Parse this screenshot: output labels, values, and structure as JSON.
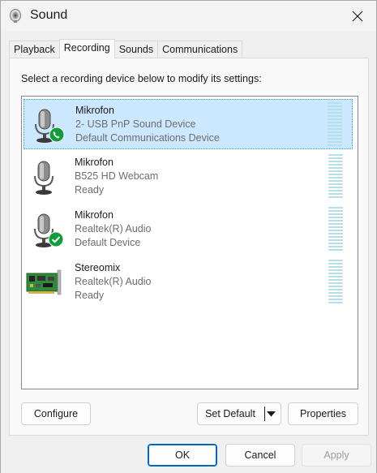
{
  "window": {
    "title": "Sound"
  },
  "tabs": [
    {
      "label": "Playback"
    },
    {
      "label": "Recording"
    },
    {
      "label": "Sounds"
    },
    {
      "label": "Communications"
    }
  ],
  "active_tab": "Recording",
  "instruction": "Select a recording device below to modify its settings:",
  "devices": [
    {
      "name": "Mikrofon",
      "detail": "2- USB PnP Sound Device",
      "status": "Default Communications Device",
      "icon": "microphone-icon",
      "badge": "phone-badge-icon",
      "selected": true
    },
    {
      "name": "Mikrofon",
      "detail": "B525 HD Webcam",
      "status": "Ready",
      "icon": "microphone-icon",
      "badge": "",
      "selected": false
    },
    {
      "name": "Mikrofon",
      "detail": "Realtek(R) Audio",
      "status": "Default Device",
      "icon": "microphone-icon",
      "badge": "checkmark-badge-icon",
      "selected": false
    },
    {
      "name": "Stereomix",
      "detail": "Realtek(R) Audio",
      "status": "Ready",
      "icon": "sound-card-icon",
      "badge": "",
      "selected": false
    }
  ],
  "buttons": {
    "configure": "Configure",
    "set_default": "Set Default",
    "properties": "Properties",
    "ok": "OK",
    "cancel": "Cancel",
    "apply": "Apply"
  },
  "colors": {
    "selection": "#cce8ff",
    "accent": "#0067c0",
    "badge_green": "#0f9d3a",
    "meter": "#b7dfe8"
  }
}
